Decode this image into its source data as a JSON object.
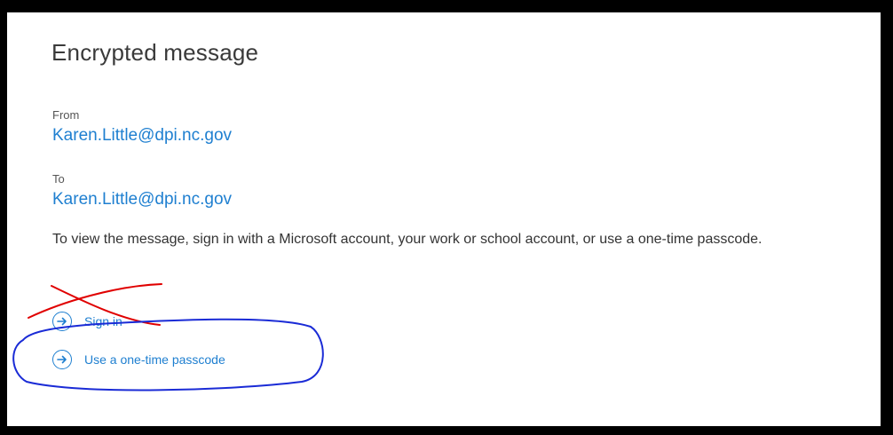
{
  "message": {
    "title": "Encrypted message",
    "from_label": "From",
    "from_email": "Karen.Little@dpi.nc.gov",
    "to_label": "To",
    "to_email": "Karen.Little@dpi.nc.gov",
    "description": "To view the message, sign in with a Microsoft account, your work or school account, or use a one-time passcode."
  },
  "actions": [
    {
      "label": "Sign in",
      "icon": "arrow-right-circle-icon",
      "crossed_out": true
    },
    {
      "label": "Use a one-time passcode",
      "icon": "arrow-right-circle-icon",
      "circled": true
    }
  ],
  "annotations": {
    "cross_color": "#e00000",
    "circle_color": "#1a2bd6"
  },
  "colors": {
    "link": "#1e7fd0",
    "text": "#333333",
    "border": "#000000"
  }
}
